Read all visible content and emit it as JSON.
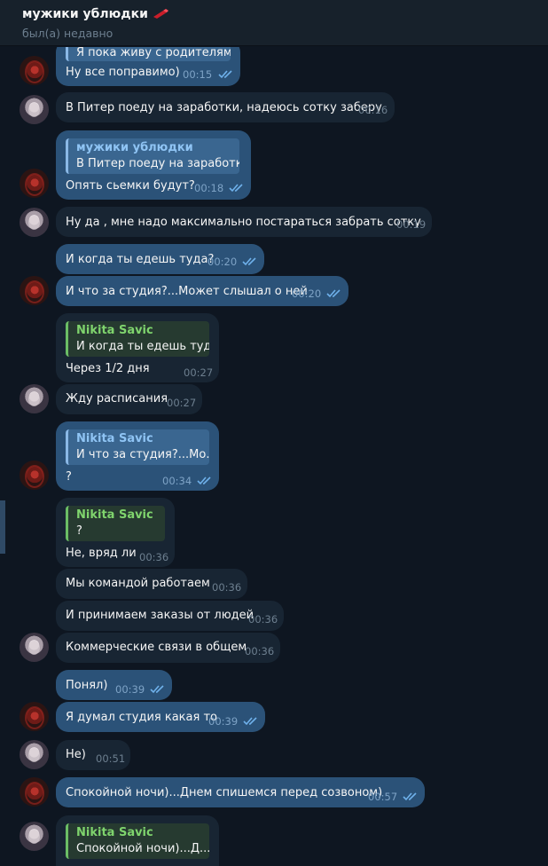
{
  "header": {
    "title": "мужики ублюдки",
    "status": "был(а) недавно"
  },
  "colors": {
    "background": "#0e1621",
    "header": "#17212b",
    "outgoing_bubble": "#2b5278",
    "incoming_bubble": "#182533",
    "read_check": "#6fb1eb",
    "quote_author_in": "#7fd46d",
    "quote_author_out": "#8fc4f4"
  },
  "messages": [
    {
      "direction": "out",
      "reply_text": "Я пока живу с родителям...",
      "text": "Ну все поправимо)",
      "time": "00:15",
      "read": true
    },
    {
      "direction": "in",
      "text": "В Питер поеду на заработки, надеюсь сотку заберу",
      "time": "00:16"
    },
    {
      "direction": "out",
      "reply_author": "мужики ублюдки",
      "reply_text": "В Питер поеду на заработк...",
      "text": "Опять сьемки будут?",
      "time": "00:18",
      "read": true
    },
    {
      "direction": "in",
      "text": "Ну да , мне надо максимально постараться забрать сотку",
      "time": "00:19"
    },
    {
      "direction": "out",
      "text": "И когда ты едешь туда?",
      "time": "00:20",
      "read": true
    },
    {
      "direction": "out",
      "text": "И что за студия?...Может слышал о ней",
      "time": "00:20",
      "read": true
    },
    {
      "direction": "in",
      "reply_author": "Nikita Savic",
      "reply_text": "И когда ты едешь туд...",
      "text": "Через 1/2 дня",
      "time": "00:27"
    },
    {
      "direction": "in",
      "text": "Жду расписания",
      "time": "00:27"
    },
    {
      "direction": "out",
      "reply_author": "Nikita Savic",
      "reply_text": "И что за студия?...Мо...",
      "text": "?",
      "time": "00:34",
      "read": true
    },
    {
      "direction": "in",
      "reply_author": "Nikita Savic",
      "reply_text": "?",
      "text": "Не, вряд ли",
      "time": "00:36"
    },
    {
      "direction": "in",
      "text": "Мы командой работаем",
      "time": "00:36"
    },
    {
      "direction": "in",
      "text": "И принимаем заказы от людей",
      "time": "00:36"
    },
    {
      "direction": "in",
      "text": "Коммерческие связи в общем",
      "time": "00:36"
    },
    {
      "direction": "out",
      "text": "Понял)",
      "time": "00:39",
      "read": true
    },
    {
      "direction": "out",
      "text": "Я думал студия какая то",
      "time": "00:39",
      "read": true
    },
    {
      "direction": "in",
      "text": "Не)",
      "time": "00:51"
    },
    {
      "direction": "out",
      "text": "Спокойной ночи)...Днем спишемся перед созвоном)",
      "time": "00:57",
      "read": true
    },
    {
      "direction": "in",
      "reply_author": "Nikita Savic",
      "reply_text": "Спокойной ночи)...Д..."
    }
  ]
}
